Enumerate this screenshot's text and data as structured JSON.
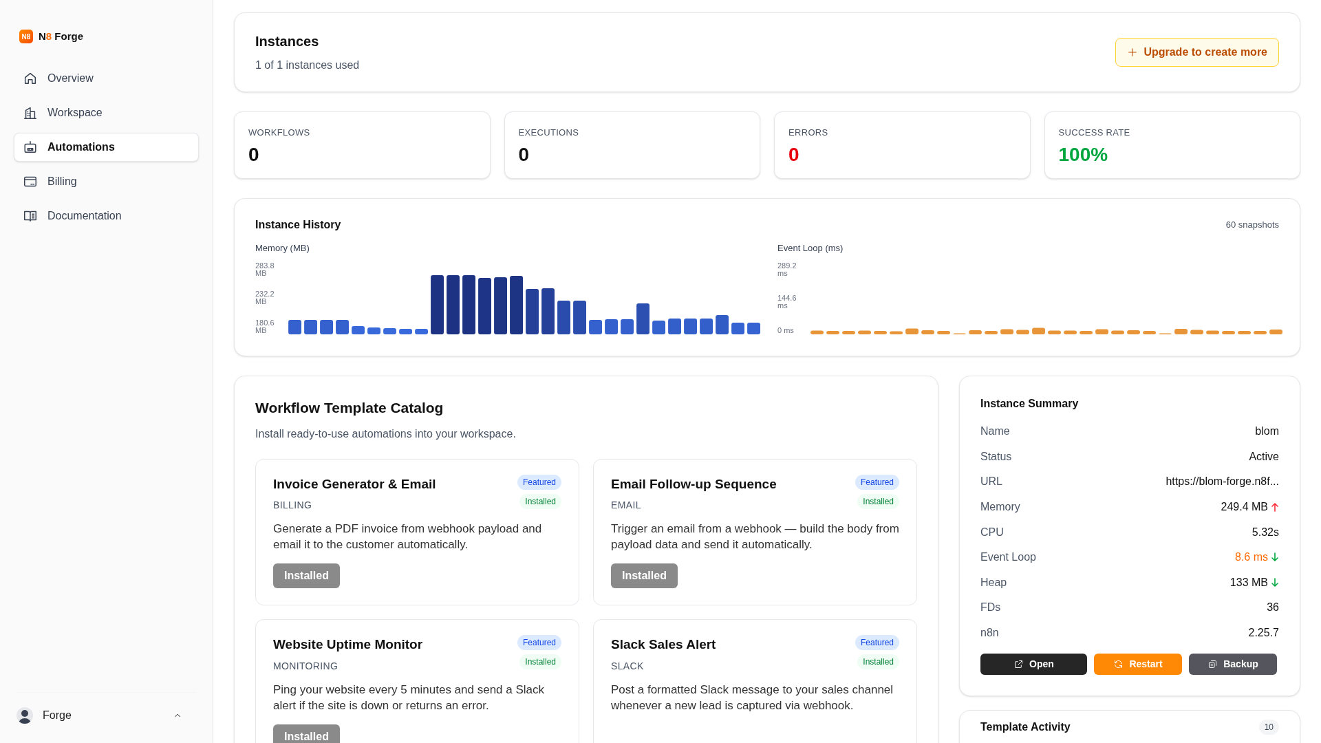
{
  "sidebar": {
    "logo_mark": "N8",
    "brand_parts": [
      {
        "text": "N",
        "accent": false
      },
      {
        "text": "8",
        "accent": true
      },
      {
        "text": " Forge",
        "accent": false
      }
    ],
    "items": [
      {
        "label": "Overview",
        "selected": false
      },
      {
        "label": "Workspace",
        "selected": false
      },
      {
        "label": "Automations",
        "selected": true
      },
      {
        "label": "Billing",
        "selected": false
      },
      {
        "label": "Documentation",
        "selected": false
      }
    ],
    "user": {
      "name": "Forge",
      "expanded": true
    }
  },
  "instances": {
    "title": "Instances",
    "subtitle": "1 of 1 instances used",
    "button": "Upgrade to create more"
  },
  "stats": [
    {
      "label": "WORKFLOWS",
      "value": "0",
      "kind": "plain"
    },
    {
      "label": "EXECUTIONS",
      "value": "0",
      "kind": "plain"
    },
    {
      "label": "ERRORS",
      "value": "0",
      "kind": "danger"
    },
    {
      "label": "SUCCESS RATE",
      "value": "100%",
      "kind": "success"
    }
  ],
  "history": {
    "title": "Instance History",
    "count": "60 snapshots",
    "charts": [
      {
        "title": "Memory (MB)",
        "kind": "memory",
        "axis_labels": [
          "283.8 MB",
          "232.2 MB",
          "180.6 MB"
        ]
      },
      {
        "title": "Event Loop (ms)",
        "kind": "event_loop",
        "axis_labels": [
          "289.2 ms",
          "144.6 ms",
          "0 ms"
        ]
      }
    ]
  },
  "catalog": {
    "title": "Workflow Template Catalog",
    "subtitle": "Install ready-to-use automations into your workspace.",
    "templates": [
      {
        "title": "Invoice Generator & Email",
        "category": "BILLING",
        "description": "Generate a PDF invoice from webhook payload and email it to the customer automatically.",
        "badges": [
          {
            "label": "Featured",
            "kind": "featured"
          },
          {
            "label": "Installed",
            "kind": "installed"
          }
        ],
        "button": {
          "label": "Installed",
          "disabled": true
        }
      },
      {
        "title": "Email Follow-up Sequence",
        "category": "EMAIL",
        "description": "Trigger an email from a webhook — build the body from payload data and send it automatically.",
        "badges": [
          {
            "label": "Featured",
            "kind": "featured"
          },
          {
            "label": "Installed",
            "kind": "installed"
          }
        ],
        "button": {
          "label": "Installed",
          "disabled": true
        }
      },
      {
        "title": "Website Uptime Monitor",
        "category": "MONITORING",
        "description": "Ping your website every 5 minutes and send a Slack alert if the site is down or returns an error.",
        "badges": [
          {
            "label": "Featured",
            "kind": "featured"
          },
          {
            "label": "Installed",
            "kind": "installed"
          }
        ],
        "button": {
          "label": "Installed",
          "disabled": true
        }
      },
      {
        "title": "Slack Sales Alert",
        "category": "SLACK",
        "description": "Post a formatted Slack message to your sales channel whenever a new lead is captured via webhook.",
        "badges": [
          {
            "label": "Featured",
            "kind": "featured"
          },
          {
            "label": "Installed",
            "kind": "installed"
          }
        ]
      }
    ]
  },
  "summary": {
    "title": "Instance Summary",
    "rows": [
      {
        "label": "Name",
        "value": "blom",
        "kind": "plain"
      },
      {
        "label": "Status",
        "value": "Active",
        "kind": "plain"
      },
      {
        "label": "URL",
        "value": "https://blom-forge.n8f...",
        "kind": "plain"
      },
      {
        "label": "Memory",
        "value": "249.4 MB",
        "kind": "rising"
      },
      {
        "label": "CPU",
        "value": "5.32s",
        "kind": "plain"
      },
      {
        "label": "Event Loop",
        "value": "8.6 ms",
        "kind": "warning_falling"
      },
      {
        "label": "Heap",
        "value": "133 MB",
        "kind": "falling"
      },
      {
        "label": "FDs",
        "value": "36",
        "kind": "plain"
      },
      {
        "label": "n8n",
        "value": "2.25.7",
        "kind": "plain"
      }
    ],
    "buttons": [
      {
        "label": "Open",
        "kind": "dark"
      },
      {
        "label": "Restart",
        "kind": "warning"
      },
      {
        "label": "Backup",
        "kind": "secondary"
      }
    ]
  },
  "activity": {
    "title": "Template Activity",
    "count": "10"
  }
}
